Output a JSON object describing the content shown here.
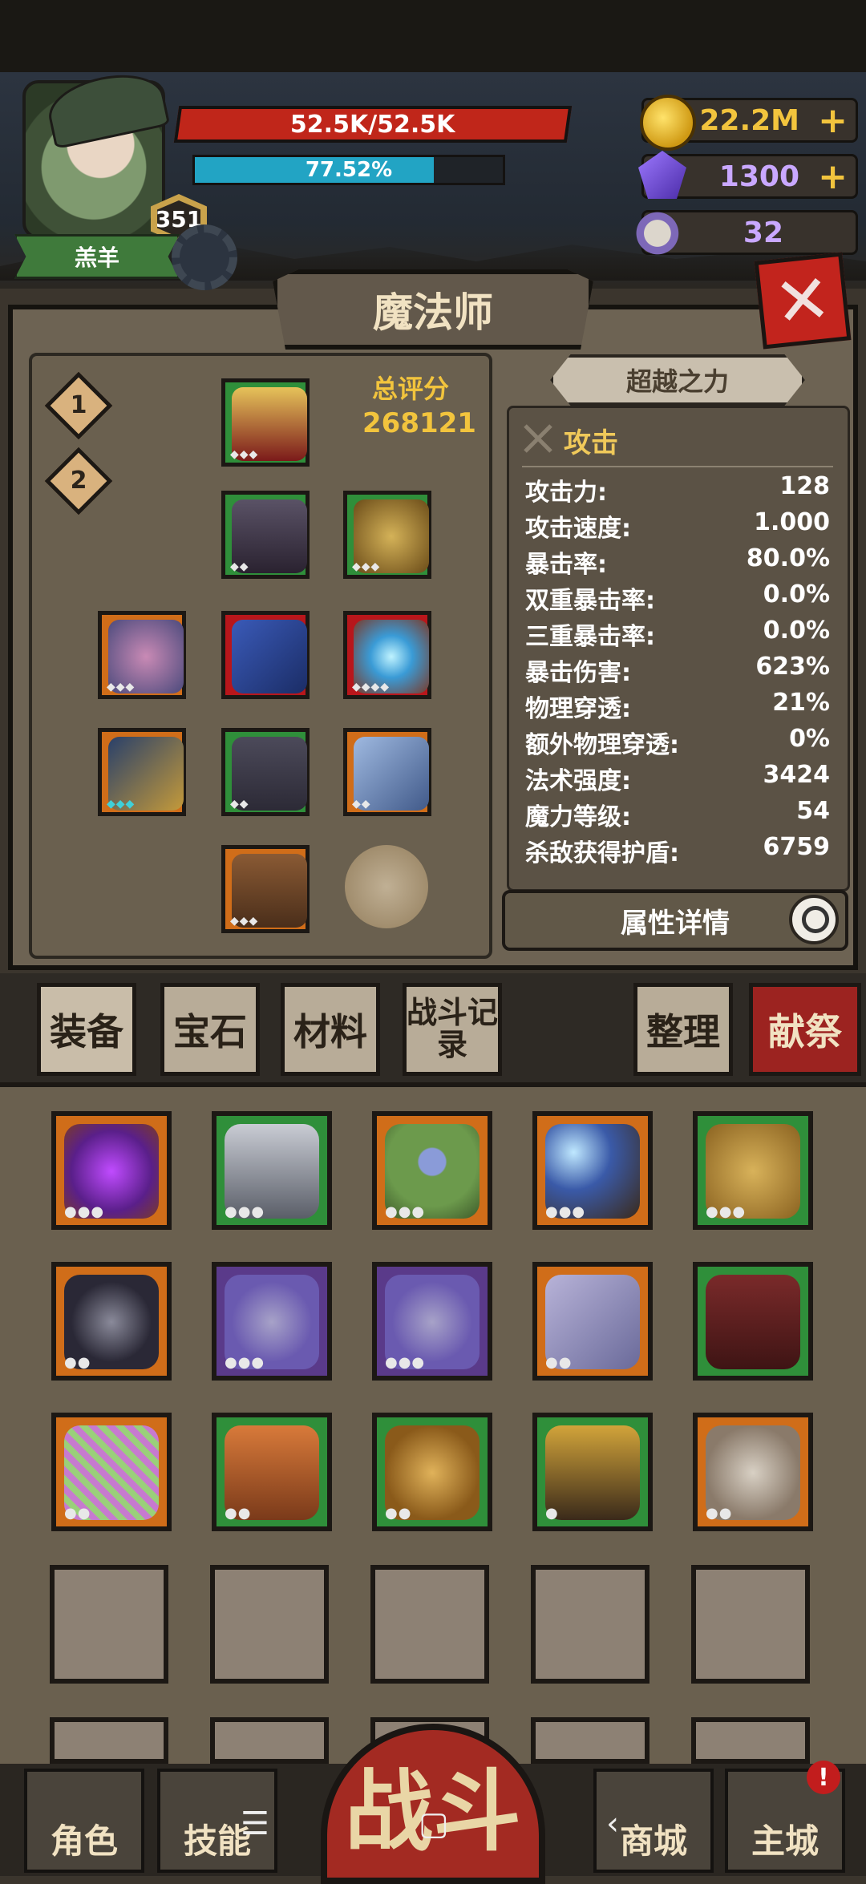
{
  "player": {
    "name": "羔羊",
    "level": "351",
    "hp_text": "52.5K/52.5K",
    "mana_text": "77.52%",
    "mana_percent": 77.52
  },
  "currencies": {
    "gold": "22.2M",
    "gems": "1300",
    "skull_tokens": "32",
    "plus": "+"
  },
  "close_icon": "close-x-icon",
  "panel": {
    "title": "魔法师",
    "loadout_1": "1",
    "loadout_2": "2",
    "total_score_label": "总评分",
    "total_score": "268121",
    "beyond_power": "超越之力",
    "stats_header": "攻击",
    "stats": [
      {
        "label": "攻击力:",
        "value": "128"
      },
      {
        "label": "攻击速度:",
        "value": "1.000"
      },
      {
        "label": "暴击率:",
        "value": "80.0%"
      },
      {
        "label": "双重暴击率:",
        "value": "0.0%"
      },
      {
        "label": "三重暴击率:",
        "value": "0.0%"
      },
      {
        "label": "暴击伤害:",
        "value": "623%"
      },
      {
        "label": "物理穿透:",
        "value": "21%"
      },
      {
        "label": "额外物理穿透:",
        "value": "0%"
      },
      {
        "label": "法术强度:",
        "value": "3424"
      },
      {
        "label": "魔力等级:",
        "value": "54"
      },
      {
        "label": "杀敌获得护盾:",
        "value": "6759"
      }
    ],
    "attr_detail": "属性详情"
  },
  "tabs": {
    "equipment": "装备",
    "gems": "宝石",
    "materials": "材料",
    "battle_log": "战斗记录",
    "sort": "整理",
    "sacrifice": "献祭"
  },
  "nav": {
    "character": "角色",
    "skills": "技能",
    "battle": "战斗",
    "shop": "商城",
    "main_city": "主城",
    "badge": "!"
  },
  "colors": {
    "hp": "#c0261a",
    "mana": "#22a4c4",
    "gold_text": "#f2c43d",
    "rarity_green": "#2f8f3a",
    "rarity_orange": "#d06d19",
    "rarity_red": "#b8161b"
  }
}
